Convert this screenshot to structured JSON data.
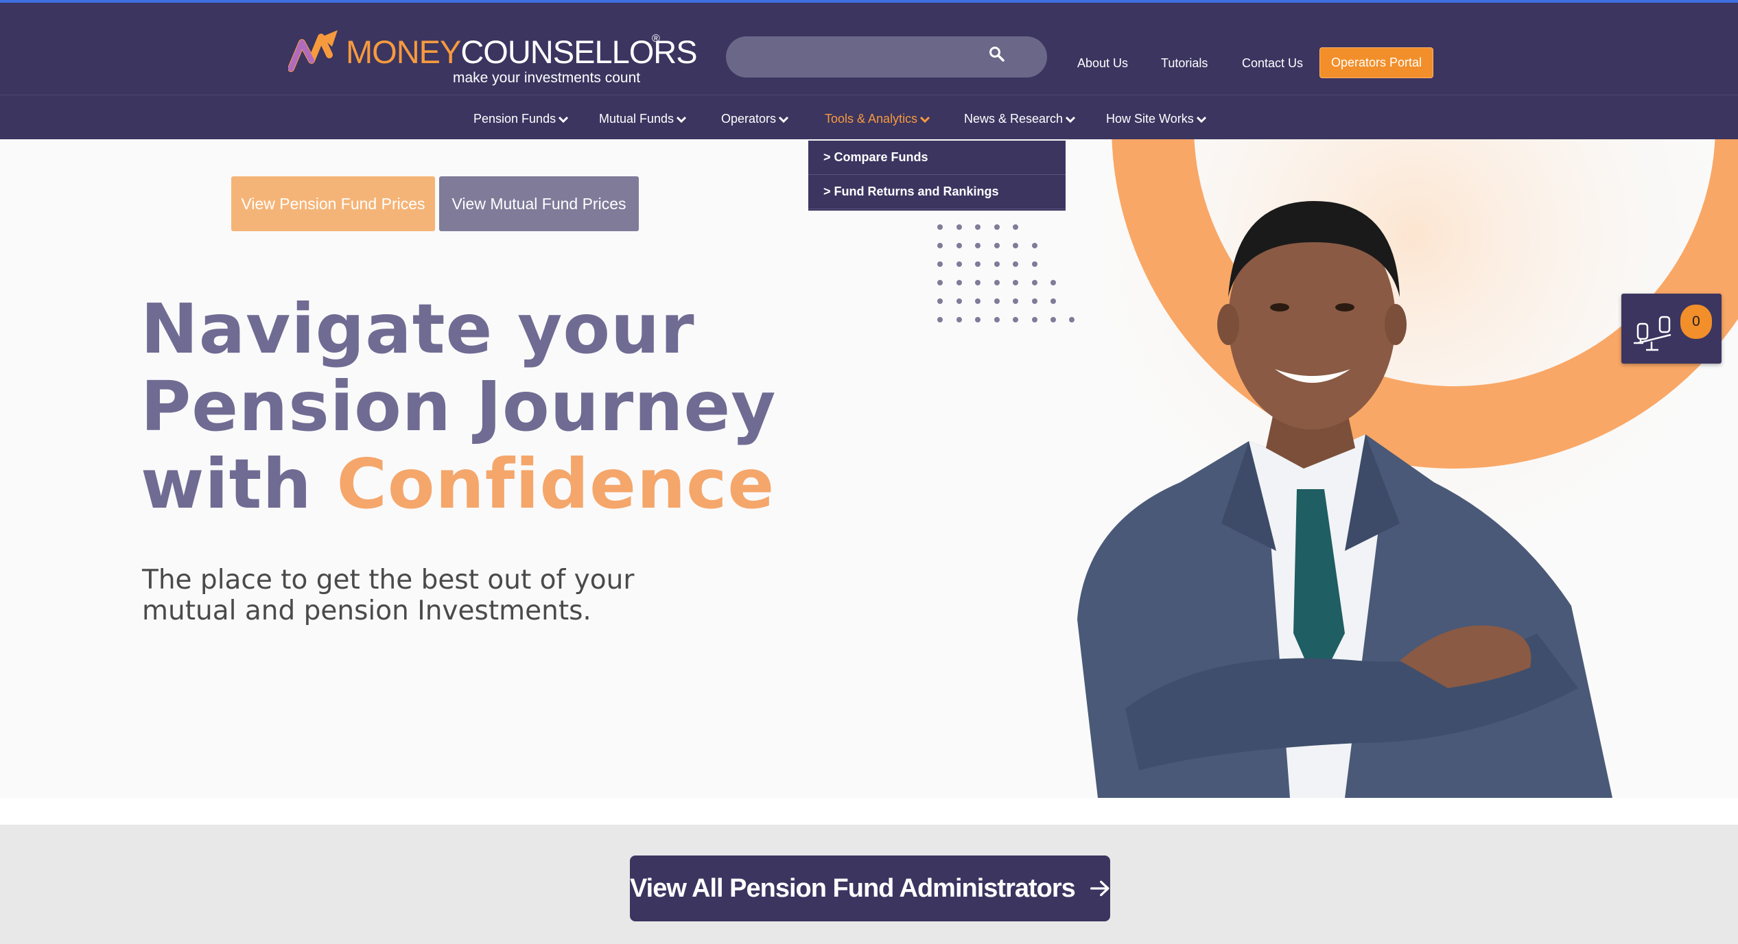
{
  "brand": {
    "name_part1": "MONEY",
    "name_part2": "COUNSELLORS",
    "registered": "®",
    "tagline": "make your investments count",
    "colors": {
      "primary": "#3b3560",
      "accent": "#f79a3e",
      "muted": "#7f7b99"
    }
  },
  "search": {
    "placeholder": "",
    "icon": "search-icon"
  },
  "top_links": [
    "About Us",
    "Tutorials",
    "Contact Us"
  ],
  "portal_button": "Operators Portal",
  "nav": {
    "items": [
      {
        "label": "Pension Funds"
      },
      {
        "label": "Mutual Funds"
      },
      {
        "label": "Operators"
      },
      {
        "label": "Tools & Analytics",
        "active": true
      },
      {
        "label": "News & Research"
      },
      {
        "label": "How Site Works"
      }
    ],
    "dropdown": [
      "> Compare Funds",
      "> Fund Returns and Rankings"
    ]
  },
  "hero": {
    "btn_pension": "View Pension Fund Prices",
    "btn_mutual": "View Mutual Fund Prices",
    "headline_1": "Navigate your",
    "headline_2": "Pension Journey",
    "headline_3a": "with ",
    "headline_3b": "Confidence",
    "subline_1": "The place to get the best out of your",
    "subline_2": "mutual and pension Investments."
  },
  "compare_widget": {
    "count": "0",
    "icon": "scale-compare-icon"
  },
  "cta": {
    "label": "View All Pension Fund Administrators",
    "icon": "arrow-right-icon"
  }
}
